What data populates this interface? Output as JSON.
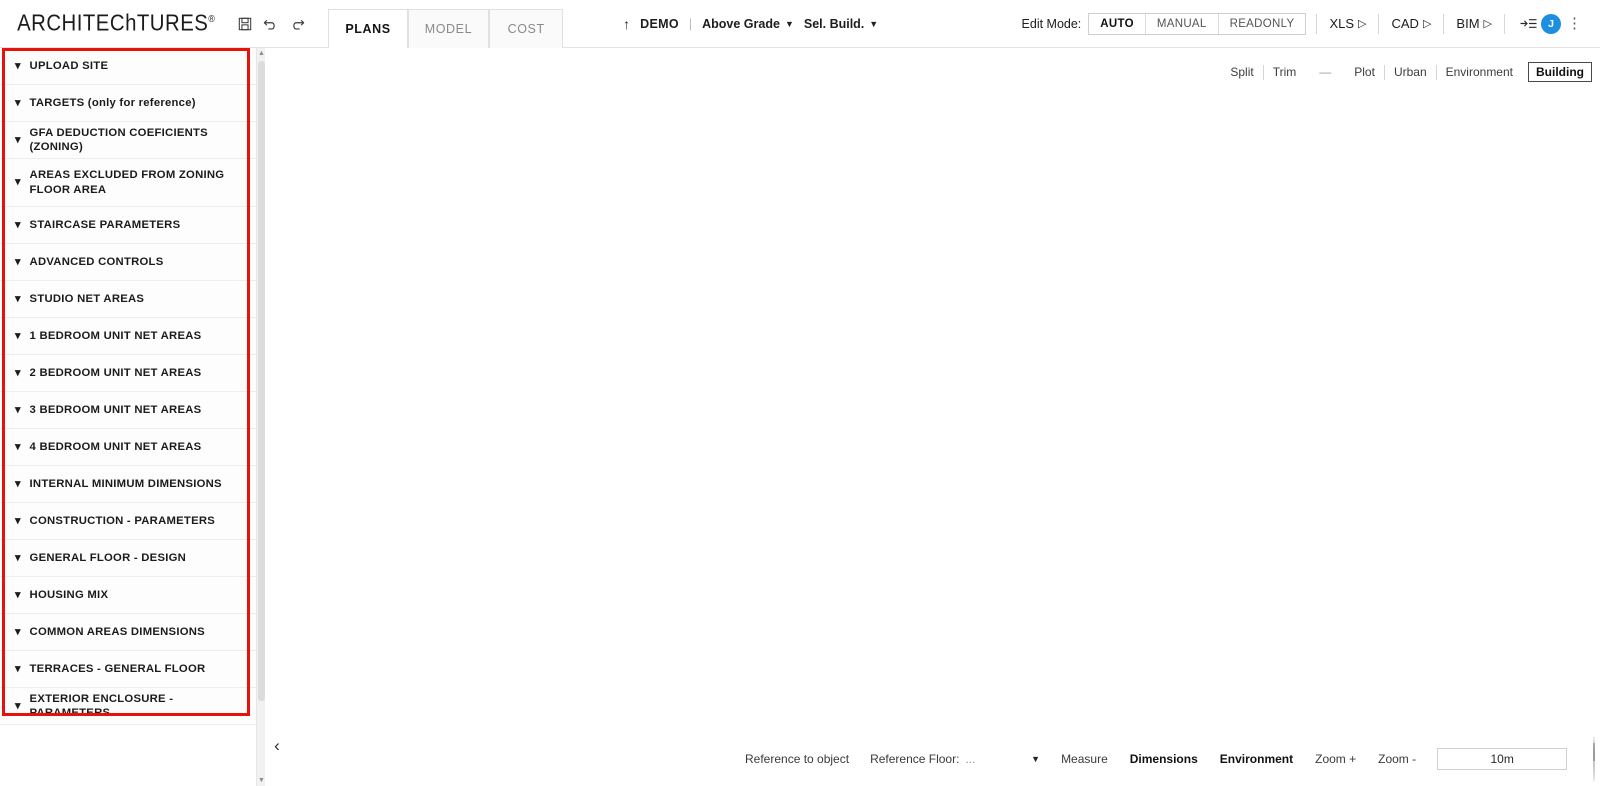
{
  "app": {
    "logo_text": "ARCHITEChTURES",
    "logo_mark": "®"
  },
  "toolbar": {
    "save_icon": "save-icon",
    "undo_icon": "undo-icon",
    "redo_icon": "redo-icon",
    "tabs": [
      {
        "label": "PLANS",
        "active": true
      },
      {
        "label": "MODEL",
        "active": false
      },
      {
        "label": "COST",
        "active": false
      }
    ],
    "project": {
      "upload_arrow": "↑",
      "name": "DEMO",
      "separator": "|",
      "grade_selector": "Above Grade",
      "building_selector": "Sel. Build."
    },
    "edit_mode": {
      "label": "Edit Mode:",
      "options": [
        {
          "label": "AUTO",
          "selected": true
        },
        {
          "label": "MANUAL",
          "selected": false
        },
        {
          "label": "READONLY",
          "selected": false
        }
      ]
    },
    "exports": [
      {
        "label": "XLS",
        "icon": "play-triangle-icon"
      },
      {
        "label": "CAD",
        "icon": "play-triangle-icon"
      },
      {
        "label": "BIM",
        "icon": "play-triangle-icon"
      }
    ],
    "panel_toggle_icon": "collapse-panel-icon",
    "avatar_initial": "J",
    "more_menu_icon": "kebab-menu-icon"
  },
  "view_toolbar": {
    "items": [
      {
        "label": "Split",
        "type": "text",
        "active": false
      },
      {
        "label": "Trim",
        "type": "text",
        "active": false
      },
      {
        "label": "—",
        "type": "dash",
        "active": false
      },
      {
        "label": "Plot",
        "type": "text",
        "active": false
      },
      {
        "label": "Urban",
        "type": "text",
        "active": false
      },
      {
        "label": "Environment",
        "type": "text",
        "active": false
      },
      {
        "label": "Building",
        "type": "boxed",
        "active": true
      }
    ]
  },
  "sidebar": {
    "highlight_color": "#e8120a",
    "collapse_icon": "chevron-left-icon",
    "scrollbar": {
      "up_arrow_icon": "scroll-up-icon",
      "down_arrow_icon": "scroll-down-icon"
    },
    "panels": [
      {
        "label": "UPLOAD SITE",
        "expand_icon": "chevron-down-icon",
        "tall": false
      },
      {
        "label": "TARGETS (only for reference)",
        "expand_icon": "chevron-down-icon",
        "tall": false
      },
      {
        "label": "GFA DEDUCTION COEFICIENTS (ZONING)",
        "expand_icon": "chevron-down-icon",
        "tall": false
      },
      {
        "label": "AREAS EXCLUDED FROM ZONING FLOOR AREA",
        "expand_icon": "chevron-down-icon",
        "tall": true
      },
      {
        "label": "STAIRCASE PARAMETERS",
        "expand_icon": "chevron-down-icon",
        "tall": false
      },
      {
        "label": "ADVANCED CONTROLS",
        "expand_icon": "chevron-down-icon",
        "tall": false
      },
      {
        "label": "STUDIO NET AREAS",
        "expand_icon": "chevron-down-icon",
        "tall": false
      },
      {
        "label": "1 BEDROOM UNIT NET AREAS",
        "expand_icon": "chevron-down-icon",
        "tall": false
      },
      {
        "label": "2 BEDROOM UNIT NET AREAS",
        "expand_icon": "chevron-down-icon",
        "tall": false
      },
      {
        "label": "3 BEDROOM UNIT NET AREAS",
        "expand_icon": "chevron-down-icon",
        "tall": false
      },
      {
        "label": "4 BEDROOM UNIT NET AREAS",
        "expand_icon": "chevron-down-icon",
        "tall": false
      },
      {
        "label": "INTERNAL MINIMUM DIMENSIONS",
        "expand_icon": "chevron-down-icon",
        "tall": false
      },
      {
        "label": "CONSTRUCTION - PARAMETERS",
        "expand_icon": "chevron-down-icon",
        "tall": false
      },
      {
        "label": "GENERAL FLOOR - DESIGN",
        "expand_icon": "chevron-down-icon",
        "tall": false
      },
      {
        "label": "HOUSING MIX",
        "expand_icon": "chevron-down-icon",
        "tall": false
      },
      {
        "label": "COMMON AREAS DIMENSIONS",
        "expand_icon": "chevron-down-icon",
        "tall": false
      },
      {
        "label": "TERRACES - GENERAL FLOOR",
        "expand_icon": "chevron-down-icon",
        "tall": false
      },
      {
        "label": "EXTERIOR ENCLOSURE - PARAMETERS",
        "expand_icon": "chevron-down-icon",
        "tall": false
      }
    ]
  },
  "bottombar": {
    "reference_to_object": "Reference to object",
    "reference_floor_label": "Reference Floor:",
    "reference_floor_value": "...",
    "reference_floor_caret_icon": "chevron-down-icon",
    "measure": "Measure",
    "dimensions": "Dimensions",
    "environment": "Environment",
    "zoom_in": "Zoom +",
    "zoom_out": "Zoom -",
    "scale_value": "10m",
    "compass_icon": "compass-icon",
    "collapse_icon": "chevron-left-icon"
  }
}
